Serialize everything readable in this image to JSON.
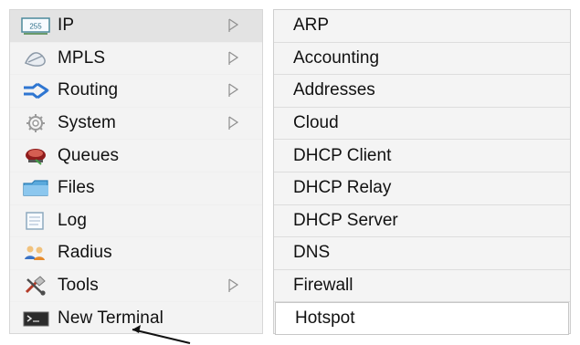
{
  "left_menu": {
    "items": [
      {
        "label": "IP",
        "icon": "ip-icon",
        "submenu": true
      },
      {
        "label": "MPLS",
        "icon": "mpls-icon",
        "submenu": true
      },
      {
        "label": "Routing",
        "icon": "routing-icon",
        "submenu": true
      },
      {
        "label": "System",
        "icon": "system-icon",
        "submenu": true
      },
      {
        "label": "Queues",
        "icon": "queues-icon",
        "submenu": false
      },
      {
        "label": "Files",
        "icon": "files-icon",
        "submenu": false
      },
      {
        "label": "Log",
        "icon": "log-icon",
        "submenu": false
      },
      {
        "label": "Radius",
        "icon": "radius-icon",
        "submenu": false
      },
      {
        "label": "Tools",
        "icon": "tools-icon",
        "submenu": true
      },
      {
        "label": "New Terminal",
        "icon": "terminal-icon",
        "submenu": false
      }
    ]
  },
  "right_menu": {
    "items": [
      {
        "label": "ARP"
      },
      {
        "label": "Accounting"
      },
      {
        "label": "Addresses"
      },
      {
        "label": "Cloud"
      },
      {
        "label": "DHCP Client"
      },
      {
        "label": "DHCP Relay"
      },
      {
        "label": "DHCP Server"
      },
      {
        "label": "DNS"
      },
      {
        "label": "Firewall"
      },
      {
        "label": "Hotspot"
      }
    ],
    "selected_label": "Hotspot"
  },
  "colors": {
    "menu_bg": "#f3f3f3",
    "submenu_bg": "#f4f4f4",
    "selected_bg": "#ffffff",
    "text": "#111111"
  }
}
